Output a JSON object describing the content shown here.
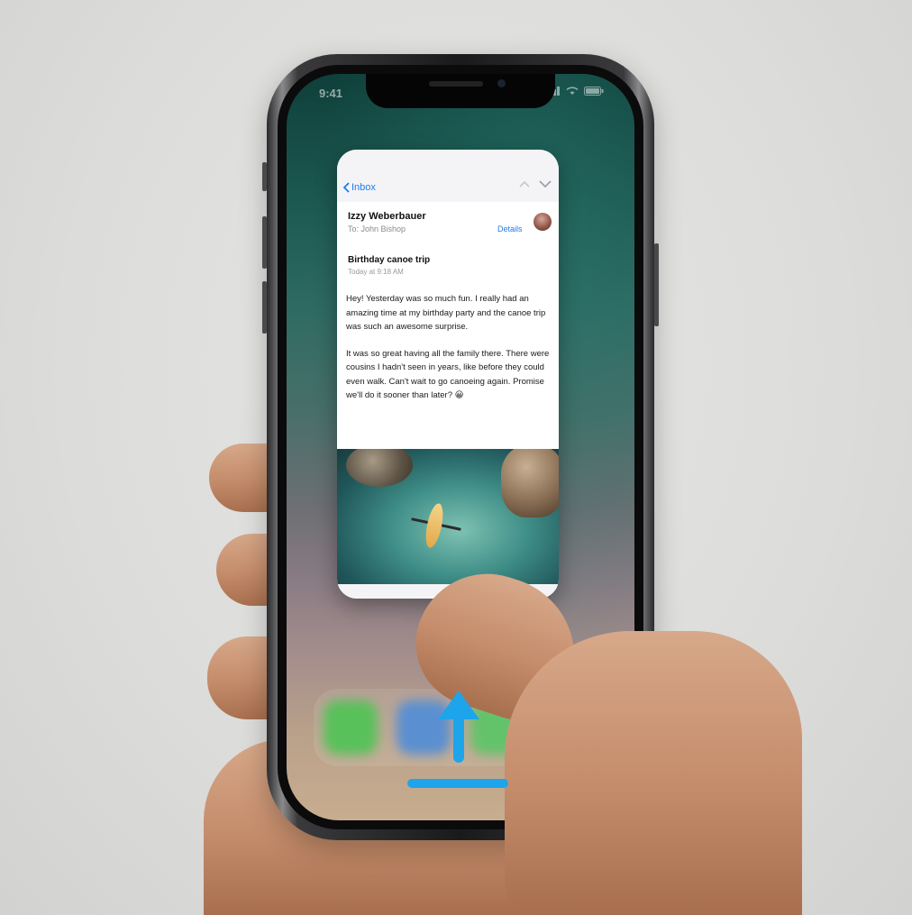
{
  "status_bar": {
    "time": "9:41",
    "icons": [
      "signal-icon",
      "wifi-icon",
      "battery-icon"
    ]
  },
  "mail_card": {
    "nav": {
      "back_label": "Inbox",
      "icons": [
        "back-chevron-icon",
        "up-chevron-icon",
        "down-chevron-icon"
      ]
    },
    "sender_name": "Izzy Weberbauer",
    "to_line": "To: John Bishop",
    "details_link": "Details",
    "subject": "Birthday canoe trip",
    "timestamp": "Today at 9:18 AM",
    "body_paragraph_1": "Hey! Yesterday was so much fun. I really had an amazing time at my birthday party and the canoe trip was such an awesome surprise.",
    "body_paragraph_2": "It was so great having all the family there. There were cousins I hadn't seen in years, like before they could even walk. Can't wait to go canoeing again. Promise we'll do it sooner than later? 😀",
    "photo": "kayak-aerial-photo"
  },
  "gesture": {
    "arrow": "swipe-up-arrow-icon",
    "home_indicator": "home-indicator"
  },
  "colors": {
    "accent_blue": "#1e7bf0",
    "gesture_blue": "#1ea4ea",
    "background": "#dcdcda"
  }
}
